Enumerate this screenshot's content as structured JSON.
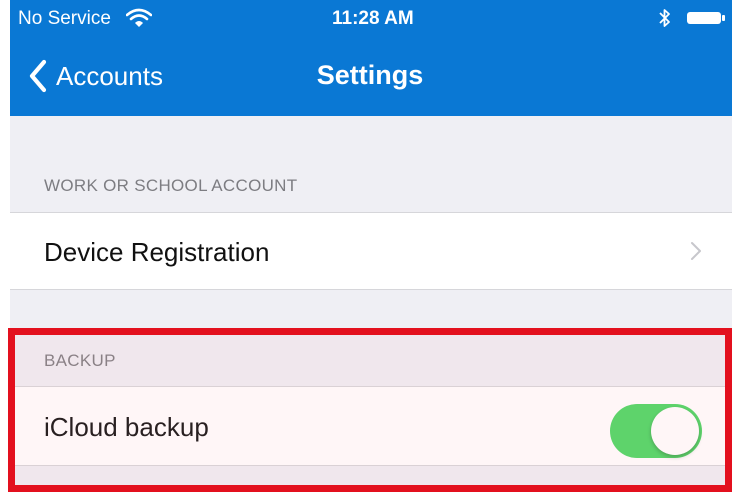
{
  "status_bar": {
    "carrier": "No Service",
    "time": "11:28 AM",
    "icons": [
      "wifi-icon",
      "bluetooth-icon",
      "battery-icon"
    ]
  },
  "nav": {
    "back_label": "Accounts",
    "title": "Settings"
  },
  "sections": {
    "work": {
      "header": "WORK OR SCHOOL ACCOUNT",
      "row_label": "Device Registration"
    },
    "backup": {
      "header": "BACKUP",
      "row_label": "iCloud backup",
      "toggle_on": true
    }
  },
  "colors": {
    "nav_bar": "#0a78d4",
    "toggle_on": "#4cd964",
    "highlight": "#e3101e"
  }
}
